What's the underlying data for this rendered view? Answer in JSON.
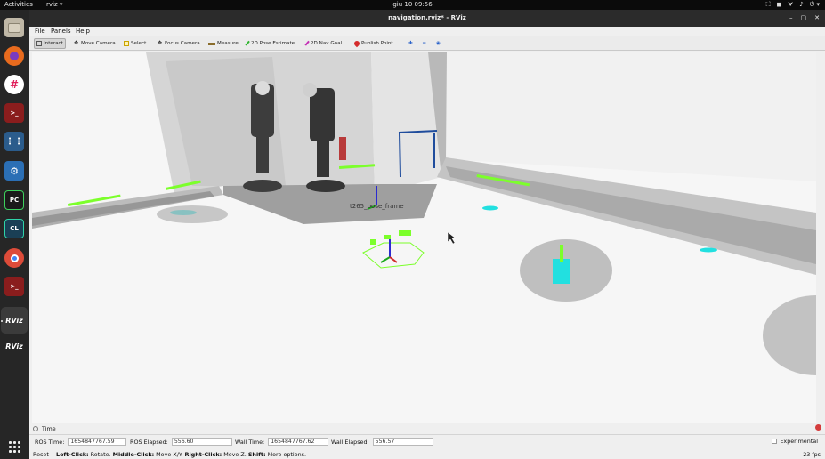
{
  "topbar": {
    "activities": "Activities",
    "app_menu": "rviz ▾",
    "clock": "giu 10  09:56",
    "tray": [
      "⛶",
      "◼",
      "⮟",
      "♪",
      "⏻ ▾"
    ]
  },
  "dock": {
    "apps": [
      {
        "name": "files",
        "glyph": "",
        "color": "#bfb7a6"
      },
      {
        "name": "firefox",
        "glyph": "",
        "color": "#e86b1e"
      },
      {
        "name": "slack",
        "glyph": "#",
        "color": "#ffffff"
      },
      {
        "name": "terminal-red",
        "glyph": ">_",
        "color": "#8a1d1d"
      },
      {
        "name": "network-tool",
        "glyph": "⋮",
        "color": "#2b5c8c"
      },
      {
        "name": "app-blue",
        "glyph": "⚙",
        "color": "#2b6fb5"
      },
      {
        "name": "pycharm",
        "glyph": "PC",
        "color": "#1b1b1b"
      },
      {
        "name": "clion",
        "glyph": "CL",
        "color": "#1a3f55"
      },
      {
        "name": "chrome",
        "glyph": "",
        "color": "#dd4b39"
      },
      {
        "name": "terminal-red-2",
        "glyph": ">_",
        "color": "#8a1d1d"
      },
      {
        "name": "rviz",
        "glyph": "RViz",
        "color": "#3b3b3b"
      },
      {
        "name": "rviz-2",
        "glyph": "RViz",
        "color": "#262626"
      }
    ],
    "show_apps_label": "Show Applications"
  },
  "window": {
    "title": "navigation.rviz* - RViz",
    "controls": [
      "–",
      "▢",
      "✕"
    ]
  },
  "menubar": {
    "items": [
      "File",
      "Panels",
      "Help"
    ]
  },
  "toolbar": {
    "tools": [
      {
        "label": "Interact",
        "active": true,
        "icon": "interact-icon"
      },
      {
        "label": "Move Camera",
        "active": false,
        "icon": "move-camera-icon"
      },
      {
        "label": "Select",
        "active": false,
        "icon": "select-icon"
      },
      {
        "label": "Focus Camera",
        "active": false,
        "icon": "focus-camera-icon"
      },
      {
        "label": "Measure",
        "active": false,
        "icon": "measure-icon"
      },
      {
        "label": "2D Pose Estimate",
        "active": false,
        "icon": "pose-estimate-icon"
      },
      {
        "label": "2D Nav Goal",
        "active": false,
        "icon": "nav-goal-icon"
      },
      {
        "label": "Publish Point",
        "active": false,
        "icon": "publish-point-icon"
      }
    ],
    "extra": [
      "✚",
      "━",
      "◉"
    ]
  },
  "view": {
    "frame_label": "t265_pose_frame",
    "colors": {
      "floor": "#f6f6f6",
      "cloud": "#d9d9d9",
      "laser": "#7cff2b",
      "costmap": "#22e0e0"
    }
  },
  "time_panel": {
    "title": "Time",
    "ros_time_label": "ROS Time:",
    "ros_time": "1654847767.59",
    "ros_elapsed_label": "ROS Elapsed:",
    "ros_elapsed": "556.60",
    "wall_time_label": "Wall Time:",
    "wall_time": "1654847767.62",
    "wall_elapsed_label": "Wall Elapsed:",
    "wall_elapsed": "556.57",
    "experimental_label": "Experimental"
  },
  "statusbar": {
    "reset_label": "Reset",
    "hint_left_bold": "Left-Click:",
    "hint_left": " Rotate. ",
    "hint_mid_bold": "Middle-Click:",
    "hint_mid": " Move X/Y. ",
    "hint_right_bold": "Right-Click:",
    "hint_right": " Move Z. ",
    "hint_shift_bold": "Shift:",
    "hint_shift": " More options.",
    "fps": "23 fps"
  }
}
